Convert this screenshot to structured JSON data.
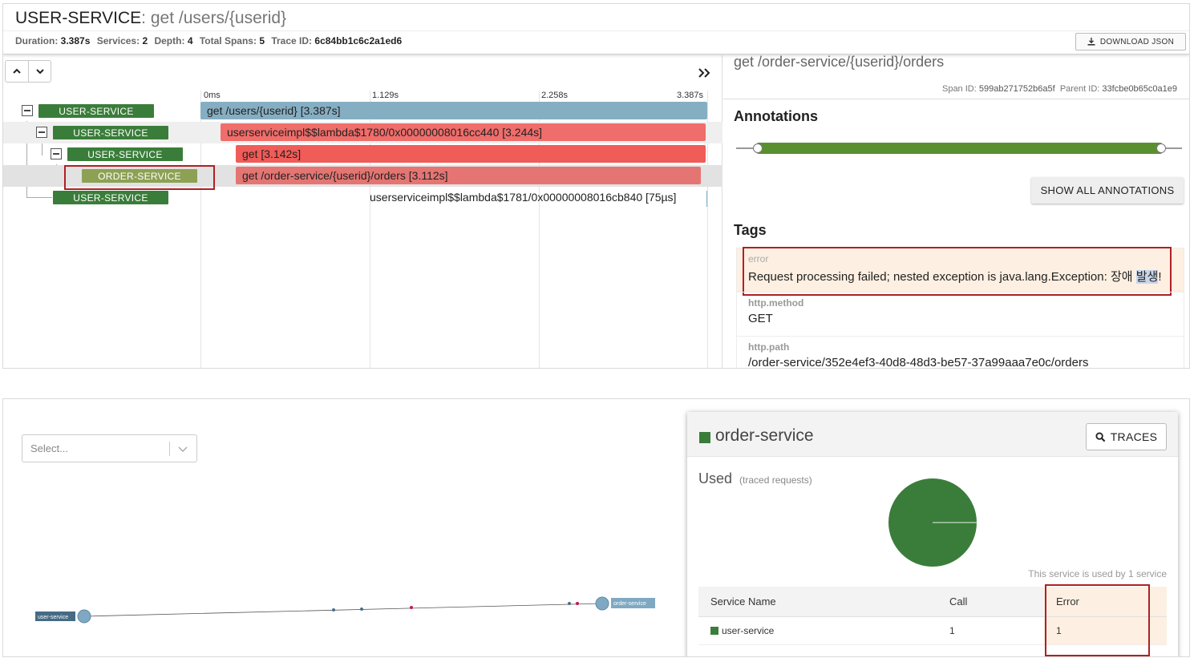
{
  "trace": {
    "service": "USER-SERVICE",
    "separator": ":",
    "operation": "get /users/{userid}",
    "meta": {
      "duration_label": "Duration:",
      "duration": "3.387s",
      "services_label": "Services:",
      "services": "2",
      "depth_label": "Depth:",
      "depth": "4",
      "spans_label": "Total Spans:",
      "spans": "5",
      "trace_id_label": "Trace ID:",
      "trace_id": "6c84bb1c6c2a1ed6"
    },
    "download_label": "DOWNLOAD JSON"
  },
  "timeline": {
    "ticks": [
      "0ms",
      "1.129s",
      "2.258s",
      "3.387s"
    ],
    "rows": [
      {
        "service": "USER-SERVICE",
        "label": "get /users/{userid} [3.387s]"
      },
      {
        "service": "USER-SERVICE",
        "label": "userserviceimpl$$lambda$1780/0x00000008016cc440 [3.244s]"
      },
      {
        "service": "USER-SERVICE",
        "label": "get [3.142s]"
      },
      {
        "service": "ORDER-SERVICE",
        "label": "get /order-service/{userid}/orders [3.112s]"
      },
      {
        "service": "USER-SERVICE",
        "label": "userserviceimpl$$lambda$1781/0x00000008016cb840 [75µs]"
      }
    ]
  },
  "detail": {
    "operation": "get /order-service/{userid}/orders",
    "span_id_label": "Span ID:",
    "span_id": "599ab271752b6a5f",
    "parent_id_label": "Parent ID:",
    "parent_id": "33fcbe0b65c0a1e9",
    "annotations_title": "Annotations",
    "show_all_label": "SHOW ALL ANNOTATIONS",
    "tags_title": "Tags",
    "tags": [
      {
        "key": "error",
        "value_main": "Request processing failed; nested exception is java.lang.Exception: 장애 ",
        "value_hl": "발생",
        "value_end": "!"
      },
      {
        "key": "http.method",
        "value": "GET"
      },
      {
        "key": "http.path",
        "value": "/order-service/352e4ef3-40d8-48d3-be57-37a99aaa7e0c/orders"
      }
    ]
  },
  "dependencies": {
    "select_placeholder": "Select...",
    "nodes": [
      {
        "label": "user-service"
      },
      {
        "label": "order-service"
      }
    ],
    "card": {
      "title": "order-service",
      "traces_label": "TRACES",
      "used_label": "Used",
      "used_sub": "(traced requests)",
      "used_by": "This service is used by 1 service",
      "columns": [
        "Service Name",
        "Call",
        "Error"
      ],
      "rows": [
        {
          "name": "user-service",
          "call": "1",
          "error": "1"
        }
      ]
    }
  },
  "colors": {
    "service_badge": "#3a7d3a",
    "order_badge": "#8da154",
    "root_bar": "#86aec3",
    "error_bar": "#ef6d6a",
    "annotation_bar": "#5a8f30",
    "highlight_box": "#b11f24"
  },
  "icons": [
    "chevron-up-icon",
    "chevron-down-icon",
    "double-chevron-right-icon",
    "download-icon",
    "search-icon"
  ]
}
